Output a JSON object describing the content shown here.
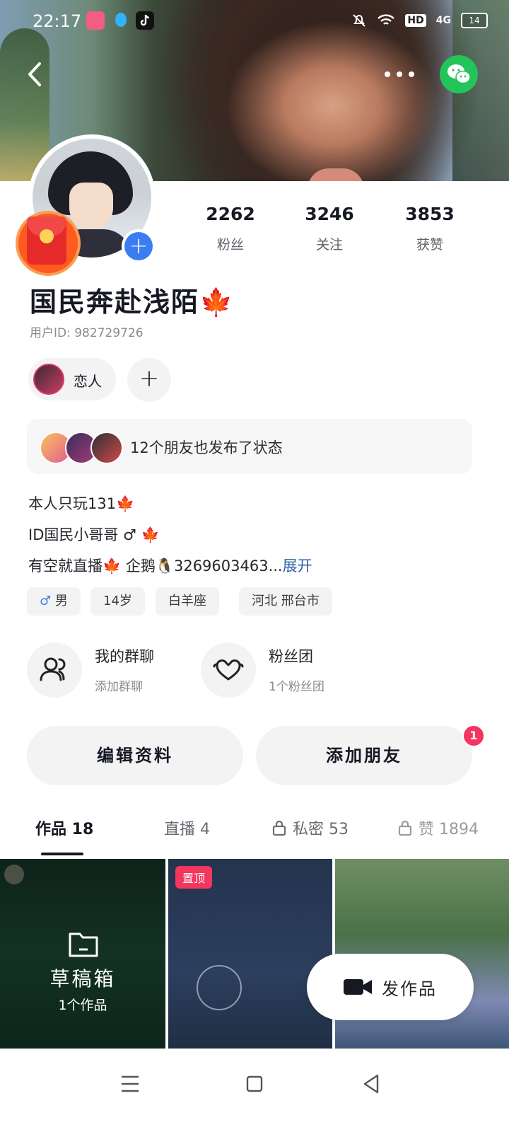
{
  "status_bar": {
    "time": "22:17",
    "hd": "HD",
    "network": "4G",
    "battery": "14"
  },
  "profile": {
    "nickname": "国民奔赴浅陌",
    "nickname_emoji": "🍁",
    "user_id": "用户ID: 982729726",
    "stats": [
      {
        "value": "2262",
        "label": "粉丝"
      },
      {
        "value": "3246",
        "label": "关注"
      },
      {
        "value": "3853",
        "label": "获赞"
      }
    ],
    "relation_chip": "恋人",
    "friends_status": "12个朋友也发布了状态",
    "bio_lines": [
      "本人只玩131🍁",
      "ID国民小哥哥 ♂ 🍁",
      "有空就直播🍁 企鹅🐧3269603463..."
    ],
    "bio_more": "展开",
    "tags": [
      "男",
      "14岁",
      "白羊座",
      "河北 邢台市"
    ],
    "group_chat": {
      "title": "我的群聊",
      "subtitle": "添加群聊"
    },
    "fan_club": {
      "title": "粉丝团",
      "subtitle": "1个粉丝团"
    },
    "edit_button": "编辑资料",
    "add_friend_button": "添加朋友",
    "add_friend_badge": "1"
  },
  "tabs": [
    {
      "label": "作品 18",
      "active": true
    },
    {
      "label": "直播 4"
    },
    {
      "label": "私密 53"
    },
    {
      "label": "赞 1894"
    }
  ],
  "grid": {
    "draft_title": "草稿箱",
    "draft_sub": "1个作品",
    "pinned_label": "置顶"
  },
  "fab_label": "发作品",
  "colors": {
    "accent_red": "#f2365e",
    "link_blue": "#2d5fa8",
    "wechat_green": "#23c45a",
    "plus_blue": "#3b7cf2"
  }
}
